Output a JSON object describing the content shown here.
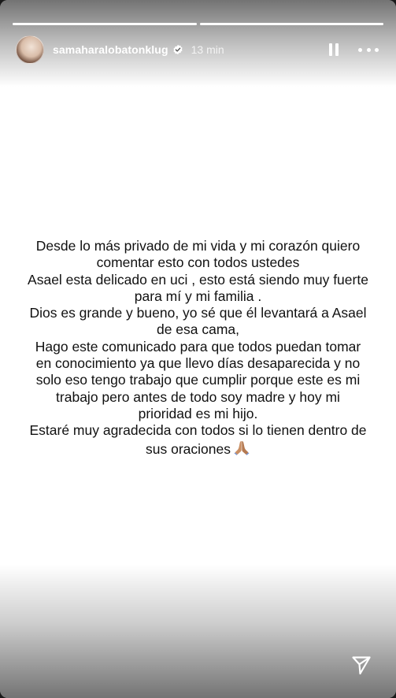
{
  "story": {
    "username": "samaharalobatonklug",
    "time_ago": "13 min",
    "segments_progress": [
      1,
      1
    ]
  },
  "post": {
    "lines": [
      "Desde lo más privado de mi vida y mi corazón quiero",
      "comentar esto con todos ustedes",
      "Asael esta delicado en uci , esto está siendo muy fuerte",
      "para mí y mi familia .",
      "Dios es grande y bueno, yo sé que él levantará a Asael",
      "de esa cama,",
      "Hago este comunicado para que todos puedan tomar",
      "en conocimiento ya que llevo días desaparecida y no",
      "solo eso tengo trabajo que cumplir porque este es mi",
      "trabajo pero antes de todo soy madre y hoy mi",
      "prioridad es mi hijo.",
      "Estaré muy agradecida con todos si lo tienen dentro de",
      "sus oraciones"
    ]
  },
  "icons": {
    "avatar": "profile-avatar",
    "verified": "verified-badge-icon",
    "pause": "pause-icon",
    "more": "more-options-icon",
    "pray": "praying-hands-icon",
    "share": "send-icon"
  },
  "colors": {
    "background": "#ffffff",
    "text": "#111111",
    "overlay_text": "#ffffff"
  }
}
